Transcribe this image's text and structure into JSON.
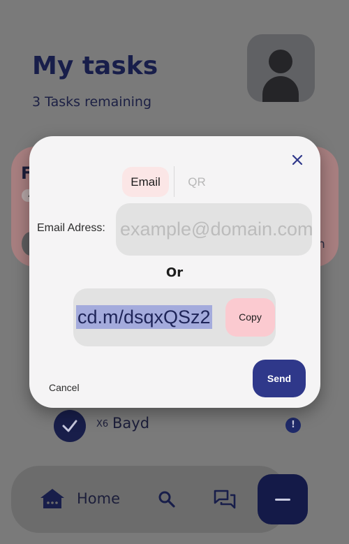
{
  "header": {
    "title": "My tasks",
    "subtitle": "3 Tasks remaining",
    "avatar_icon": "user-avatar-icon"
  },
  "background_card": {
    "title_initial": "F",
    "chip_text": "4",
    "right_text": "h"
  },
  "task": {
    "multiplier": "X6",
    "name": "Bayd",
    "done": true,
    "info_icon": "!"
  },
  "bottom_nav": {
    "home_label": "Home",
    "icons": [
      "home-icon",
      "search-icon",
      "chat-icon"
    ],
    "fab_icon": "minus-icon"
  },
  "dialog": {
    "tabs": [
      {
        "label": "Email",
        "active": true
      },
      {
        "label": "QR",
        "active": false
      }
    ],
    "email_label": "Email Adress:",
    "email_placeholder": "example@domain.com",
    "email_value": "",
    "or_label": "Or",
    "share_link": "cd.m/dsqxQSz2",
    "copy_label": "Copy",
    "cancel_label": "Cancel",
    "send_label": "Send"
  },
  "colors": {
    "primary": "#2f388a",
    "dark_navy": "#141a48",
    "tab_active_bg": "#fbe6e6",
    "copy_bg": "#fbcad0",
    "overlay": "#7a7a7a"
  }
}
